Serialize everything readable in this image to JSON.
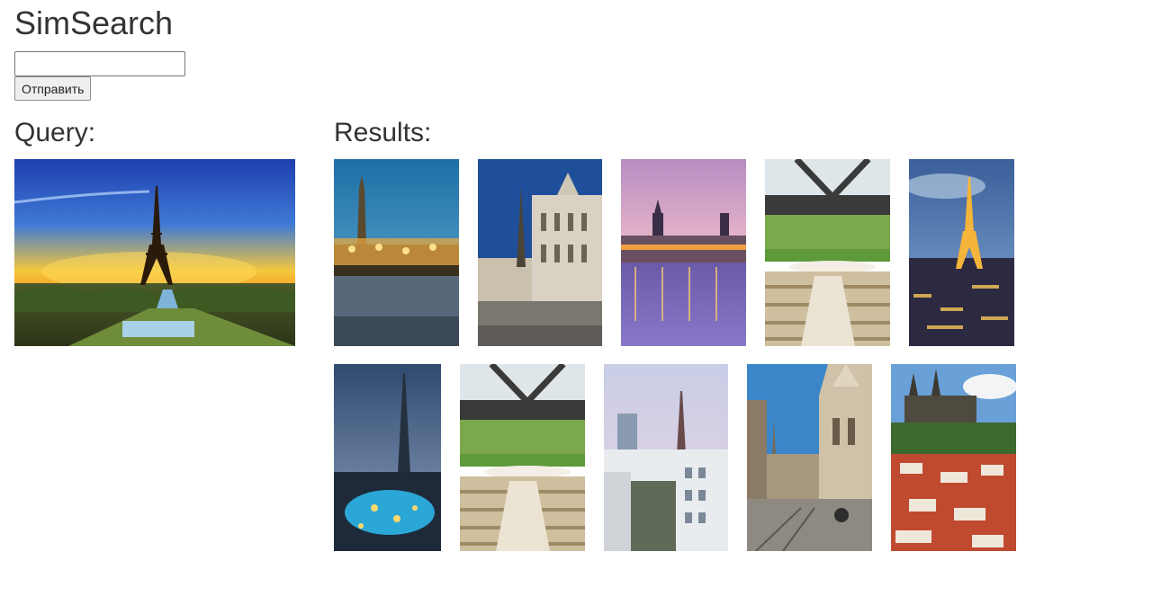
{
  "app": {
    "title": "SimSearch"
  },
  "search": {
    "input_value": "",
    "submit_label": "Отправить"
  },
  "query": {
    "heading": "Query:",
    "image_subject": "eiffel-tower-sunset"
  },
  "results": {
    "heading": "Results:",
    "rows": [
      [
        {
          "subject": "vienna-city-hall-christmas-market"
        },
        {
          "subject": "gothic-square-bruges"
        },
        {
          "subject": "moscow-river-night-lights"
        },
        {
          "subject": "park-amphitheater-glass-canopy"
        },
        {
          "subject": "eiffel-tower-night-aerial"
        }
      ],
      [
        {
          "subject": "burj-khalifa-dusk"
        },
        {
          "subject": "park-amphitheater-glass-canopy"
        },
        {
          "subject": "paris-rooftops-eiffel-tower"
        },
        {
          "subject": "gothic-cathedral-street-tram"
        },
        {
          "subject": "prague-castle-rooftops"
        }
      ]
    ]
  },
  "colors": {
    "text": "#333333",
    "button_bg": "#efefef",
    "input_border": "#767676"
  }
}
